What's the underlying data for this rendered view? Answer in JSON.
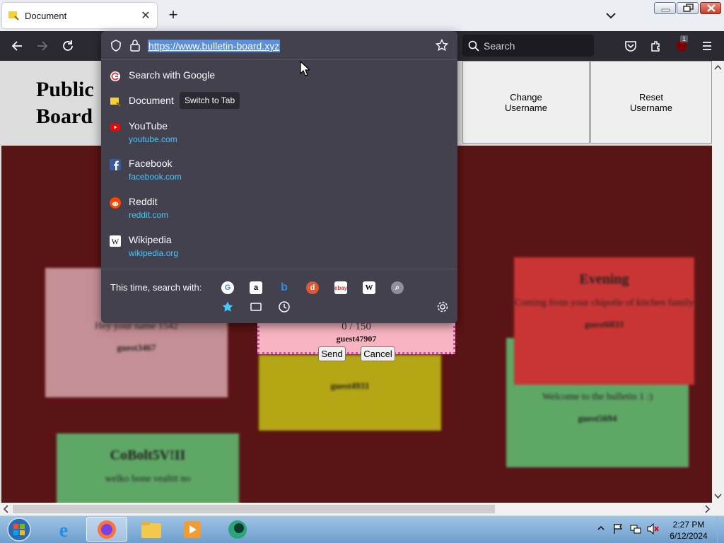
{
  "browser": {
    "tab_title": "Document",
    "url": "https://www.bulletin-board.xyz",
    "search_placeholder": "Search",
    "extension_badge": "1"
  },
  "page": {
    "title_line1": "Public",
    "title_line2": "Board",
    "buttons": [
      {
        "label": "Change\nUsername"
      },
      {
        "label": "Reset\nUsername"
      }
    ],
    "notes": [
      {
        "title": "",
        "body": "Hey your name 1542",
        "author": "guest3467"
      },
      {
        "title": "",
        "body": "",
        "author": "guest4931"
      },
      {
        "title": "Evening",
        "body": "Coming from your chipotle of kitchen family",
        "author": "guest6833"
      },
      {
        "title": "",
        "body": "Welcome to the bulletin 1 :)",
        "author": "guest5694"
      },
      {
        "title": "CoBolt5V!II",
        "body": "welko bone vealtit no",
        "author": ""
      }
    ],
    "compose": {
      "counter": "0 / 150",
      "username": "guest47907",
      "send_label": "Send",
      "cancel_label": "Cancel"
    }
  },
  "url_dropdown": {
    "suggestions": [
      {
        "title": "Search with Google",
        "url": "",
        "icon": "google-icon"
      },
      {
        "title": "Document",
        "url": "",
        "icon": "document-icon"
      },
      {
        "title": "YouTube",
        "url": "youtube.com",
        "icon": "youtube-icon"
      },
      {
        "title": "Facebook",
        "url": "facebook.com",
        "icon": "facebook-icon"
      },
      {
        "title": "Reddit",
        "url": "reddit.com",
        "icon": "reddit-icon"
      },
      {
        "title": "Wikipedia",
        "url": "wikipedia.org",
        "icon": "wikipedia-icon"
      }
    ],
    "switch_tab_label": "Switch to Tab",
    "search_with_label": "This time, search with:",
    "engines": [
      "google-icon",
      "amazon-icon",
      "bing-icon",
      "duckduckgo-icon",
      "ebay-icon",
      "wikipedia-icon",
      "search-icon"
    ],
    "accent_color": "#45c8ff"
  },
  "taskbar": {
    "time": "2:27 PM",
    "date": "6/12/2024"
  }
}
